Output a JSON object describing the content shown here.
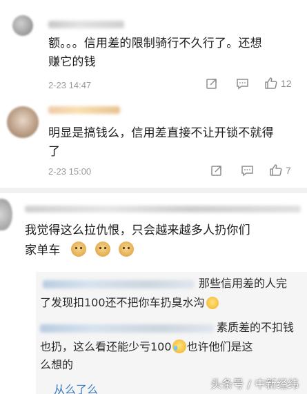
{
  "comments": [
    {
      "text_line1": "额。。。信用差的限制骑行不久行了。还想",
      "text_line2": "赚它的钱",
      "time": "2-23 14:47",
      "likes": "12"
    },
    {
      "text_line1": "明显是搞钱么，信用差直接不让开锁不就得",
      "text_line2": "了",
      "time": "2-23 15:00",
      "likes": "7"
    },
    {
      "text_line1": "我觉得这么拉仇恨，只会越来越多人扔你们",
      "text_line2": "家单车"
    }
  ],
  "replies": [
    {
      "line1_tail": "那些信用差的人完",
      "line2": "了发现扣100还不把你车扔臭水沟"
    },
    {
      "line1_tail": "素质差的不扣钱",
      "line2_a": "也扔，这么看还能少亏100",
      "line2_b": "也许他们是这",
      "line3": "么想的",
      "line4": "从么了么"
    }
  ],
  "icons": {
    "share": "share-icon",
    "comment": "comment-icon",
    "like": "thumbs-up-icon"
  },
  "colors": {
    "text": "#1b1b1b",
    "meta": "#9b9b9b",
    "reply_bg": "#f5f5f5",
    "divider": "#f1f1f1"
  },
  "watermark": "头条号 / 中新经纬"
}
